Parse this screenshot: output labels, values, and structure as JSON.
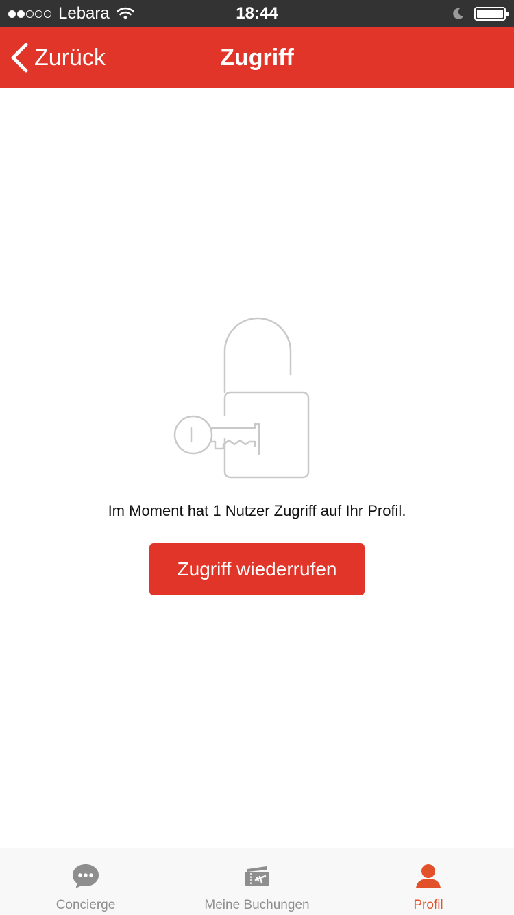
{
  "status_bar": {
    "carrier": "Lebara",
    "time": "18:44",
    "signal_icon": "signal-dots-icon",
    "wifi_icon": "wifi-icon",
    "moon_icon": "moon-icon",
    "battery_icon": "battery-icon"
  },
  "nav": {
    "back_label": "Zurück",
    "back_icon": "chevron-left-icon",
    "title": "Zugriff",
    "color": "#e2352a"
  },
  "main": {
    "illustration_icon": "padlock-key-icon",
    "message": "Im Moment hat 1 Nutzer Zugriff auf Ihr Profil.",
    "revoke_button_label": "Zugriff wiederrufen"
  },
  "tabs": [
    {
      "label": "Concierge",
      "icon": "chat-bubble-icon",
      "active": false
    },
    {
      "label": "Meine Buchungen",
      "icon": "ticket-icon",
      "active": false
    },
    {
      "label": "Profil",
      "icon": "person-icon",
      "active": true
    }
  ],
  "colors": {
    "accent": "#e2352a",
    "tab_active": "#e2512a",
    "tab_inactive": "#8e8e8e"
  }
}
